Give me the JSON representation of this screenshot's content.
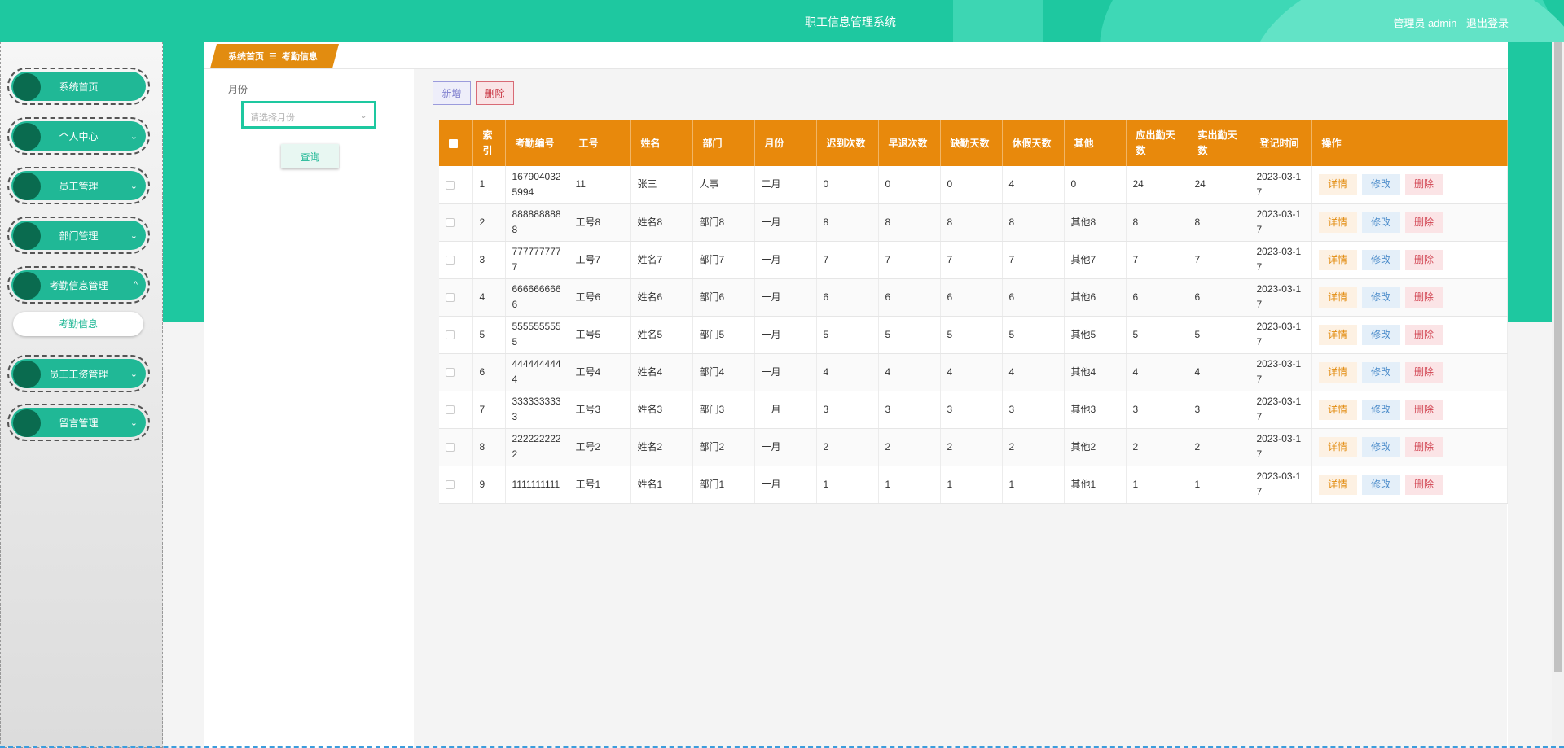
{
  "header": {
    "title": "职工信息管理系统",
    "user_label": "管理员 admin",
    "logout_label": "退出登录"
  },
  "sidebar": {
    "items": [
      {
        "label": "系统首页",
        "chevron": ""
      },
      {
        "label": "个人中心",
        "chevron": "⌄"
      },
      {
        "label": "员工管理",
        "chevron": "⌄"
      },
      {
        "label": "部门管理",
        "chevron": "⌄"
      },
      {
        "label": "考勤信息管理",
        "chevron": "^"
      },
      {
        "label": "员工工资管理",
        "chevron": "⌄"
      },
      {
        "label": "留言管理",
        "chevron": "⌄"
      }
    ],
    "active_sub": "考勤信息"
  },
  "breadcrumb": {
    "home": "系统首页",
    "sep": "☰",
    "current": "考勤信息"
  },
  "filter": {
    "label": "月份",
    "placeholder": "请选择月份",
    "query_label": "查询"
  },
  "toolbar": {
    "add_label": "新增",
    "delete_label": "删除"
  },
  "table": {
    "headers": [
      "",
      "索引",
      "考勤编号",
      "工号",
      "姓名",
      "部门",
      "月份",
      "迟到次数",
      "早退次数",
      "缺勤天数",
      "休假天数",
      "其他",
      "应出勤天数",
      "实出勤天数",
      "登记时间",
      "操作"
    ],
    "rows": [
      [
        "1",
        "1679040325994",
        "11",
        "张三",
        "人事",
        "二月",
        "0",
        "0",
        "0",
        "4",
        "0",
        "24",
        "24",
        "2023-03-17"
      ],
      [
        "2",
        "8888888888",
        "工号8",
        "姓名8",
        "部门8",
        "一月",
        "8",
        "8",
        "8",
        "8",
        "其他8",
        "8",
        "8",
        "2023-03-17"
      ],
      [
        "3",
        "7777777777",
        "工号7",
        "姓名7",
        "部门7",
        "一月",
        "7",
        "7",
        "7",
        "7",
        "其他7",
        "7",
        "7",
        "2023-03-17"
      ],
      [
        "4",
        "6666666666",
        "工号6",
        "姓名6",
        "部门6",
        "一月",
        "6",
        "6",
        "6",
        "6",
        "其他6",
        "6",
        "6",
        "2023-03-17"
      ],
      [
        "5",
        "5555555555",
        "工号5",
        "姓名5",
        "部门5",
        "一月",
        "5",
        "5",
        "5",
        "5",
        "其他5",
        "5",
        "5",
        "2023-03-17"
      ],
      [
        "6",
        "4444444444",
        "工号4",
        "姓名4",
        "部门4",
        "一月",
        "4",
        "4",
        "4",
        "4",
        "其他4",
        "4",
        "4",
        "2023-03-17"
      ],
      [
        "7",
        "3333333333",
        "工号3",
        "姓名3",
        "部门3",
        "一月",
        "3",
        "3",
        "3",
        "3",
        "其他3",
        "3",
        "3",
        "2023-03-17"
      ],
      [
        "8",
        "2222222222",
        "工号2",
        "姓名2",
        "部门2",
        "一月",
        "2",
        "2",
        "2",
        "2",
        "其他2",
        "2",
        "2",
        "2023-03-17"
      ],
      [
        "9",
        "1111111111",
        "工号1",
        "姓名1",
        "部门1",
        "一月",
        "1",
        "1",
        "1",
        "1",
        "其他1",
        "1",
        "1",
        "2023-03-17"
      ]
    ],
    "actions": [
      "详情",
      "修改",
      "删除"
    ]
  },
  "colors": {
    "primary": "#1ec8a0",
    "table_header": "#e8890c",
    "breadcrumb": "#e28c10"
  }
}
